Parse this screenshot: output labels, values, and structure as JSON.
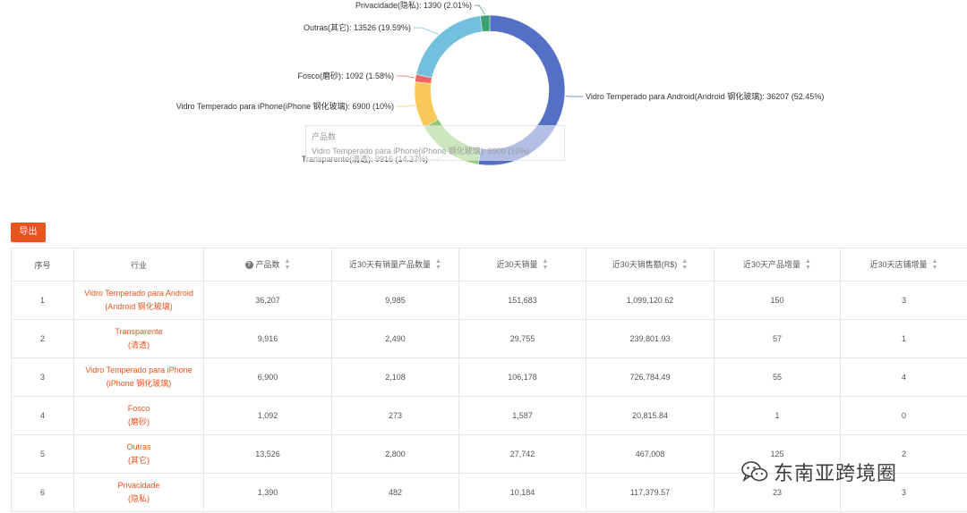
{
  "chart_data": {
    "type": "pie",
    "variant": "donut",
    "slices": [
      {
        "label": "Vidro Temperado para Android(Android 钢化玻璃): 36207 (52.45%)",
        "name": "Vidro Temperado para Android(Android 钢化玻璃)",
        "value": 36207,
        "percent": 52.45,
        "color": "#5470c6"
      },
      {
        "label": "Transparente(清透): 9916 (14.37%)",
        "name": "Transparente(清透)",
        "value": 9916,
        "percent": 14.37,
        "color": "#91cc75"
      },
      {
        "label": "Vidro Temperado para iPhone(iPhone 钢化玻璃): 6900 (10%)",
        "name": "Vidro Temperado para iPhone(iPhone 钢化玻璃)",
        "value": 6900,
        "percent": 10,
        "color": "#fac858"
      },
      {
        "label": "Fosco(磨砂): 1092 (1.58%)",
        "name": "Fosco(磨砂)",
        "value": 1092,
        "percent": 1.58,
        "color": "#ee6666"
      },
      {
        "label": "Outras(其它): 13526 (19.59%)",
        "name": "Outras(其它)",
        "value": 13526,
        "percent": 19.59,
        "color": "#73c0de"
      },
      {
        "label": "Privacidade(隐私): 1390 (2.01%)",
        "name": "Privacidade(隐私)",
        "value": 1390,
        "percent": 2.01,
        "color": "#3ba272"
      }
    ]
  },
  "tooltip": {
    "title": "产品数",
    "text": "Vidro Temperado para iPhone(iPhone 钢化玻璃): 6900 (10%)"
  },
  "toolbar": {
    "export_label": "导出"
  },
  "table": {
    "headers": {
      "index": "序号",
      "industry": "行业",
      "product_count": "产品数",
      "sold_products_30d": "近30天有销量产品数量",
      "sales_30d": "近30天销量",
      "revenue_30d": "近30天销售额(R$)",
      "new_products_30d": "近30天产品增量",
      "new_shops_30d": "近30天店铺增量"
    },
    "rows": [
      {
        "index": "1",
        "industry_line1": "Vidro Temperado para Android",
        "industry_line2": "(Android 钢化玻璃)",
        "product_count": "36,207",
        "sold_products_30d": "9,985",
        "sales_30d": "151,683",
        "revenue_30d": "1,099,120.62",
        "new_products_30d": "150",
        "new_shops_30d": "3"
      },
      {
        "index": "2",
        "industry_line1": "Transparente",
        "industry_line2": "(清透)",
        "product_count": "9,916",
        "sold_products_30d": "2,490",
        "sales_30d": "29,755",
        "revenue_30d": "239,801.93",
        "new_products_30d": "57",
        "new_shops_30d": "1"
      },
      {
        "index": "3",
        "industry_line1": "Vidro Temperado para iPhone",
        "industry_line2": "(iPhone 钢化玻璃)",
        "product_count": "6,900",
        "sold_products_30d": "2,108",
        "sales_30d": "106,178",
        "revenue_30d": "726,784.49",
        "new_products_30d": "55",
        "new_shops_30d": "4"
      },
      {
        "index": "4",
        "industry_line1": "Fosco",
        "industry_line2": "(磨砂)",
        "product_count": "1,092",
        "sold_products_30d": "273",
        "sales_30d": "1,587",
        "revenue_30d": "20,815.84",
        "new_products_30d": "1",
        "new_shops_30d": "0"
      },
      {
        "index": "5",
        "industry_line1": "Outras",
        "industry_line2": "(其它)",
        "product_count": "13,526",
        "sold_products_30d": "2,800",
        "sales_30d": "27,742",
        "revenue_30d": "467,008",
        "new_products_30d": "125",
        "new_shops_30d": "2"
      },
      {
        "index": "6",
        "industry_line1": "Privacidade",
        "industry_line2": "(隐私)",
        "product_count": "1,390",
        "sold_products_30d": "482",
        "sales_30d": "10,184",
        "revenue_30d": "117,379.57",
        "new_products_30d": "23",
        "new_shops_30d": "3"
      }
    ]
  },
  "watermark": {
    "text": "东南亚跨境圈",
    "icon": "wechat-icon"
  }
}
